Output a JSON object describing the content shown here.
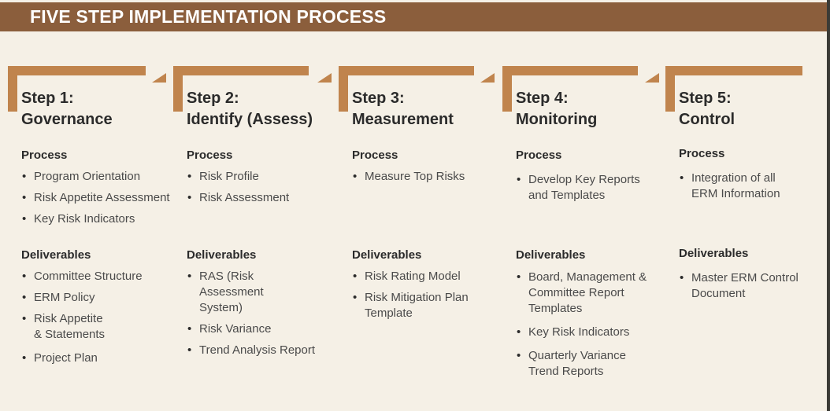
{
  "header": {
    "title": "FIVE STEP IMPLEMENTATION PROCESS"
  },
  "colors": {
    "header_bg": "#8B5E3C",
    "bracket": "#C0844D",
    "background": "#F5F0E6"
  },
  "labels": {
    "process": "Process",
    "deliverables": "Deliverables"
  },
  "steps": [
    {
      "number_label": "Step 1:",
      "name": "Governance",
      "process": [
        "Program Orientation",
        "Risk Appetite Assessment",
        "Key Risk Indicators"
      ],
      "deliverables": [
        "Committee Structure",
        "ERM Policy",
        "Risk Appetite & Statements",
        "Project Plan"
      ]
    },
    {
      "number_label": "Step 2:",
      "name": "Identify (Assess)",
      "process": [
        "Risk Profile",
        "Risk Assessment"
      ],
      "deliverables": [
        "RAS (Risk Assessment System)",
        "Risk Variance",
        "Trend Analysis Report"
      ]
    },
    {
      "number_label": "Step 3:",
      "name": "Measurement",
      "process": [
        "Measure Top Risks"
      ],
      "deliverables": [
        "Risk Rating Model",
        "Risk Mitigation Plan Template"
      ]
    },
    {
      "number_label": "Step 4:",
      "name": "Monitoring",
      "process": [
        "Develop Key Reports and Templates"
      ],
      "deliverables": [
        "Board, Management & Committee Report Templates",
        "Key Risk Indicators",
        "Quarterly Variance Trend Reports"
      ]
    },
    {
      "number_label": "Step 5:",
      "name": "Control",
      "process": [
        "Integration of all ERM Information"
      ],
      "deliverables": [
        "Master ERM Control Document"
      ]
    }
  ]
}
